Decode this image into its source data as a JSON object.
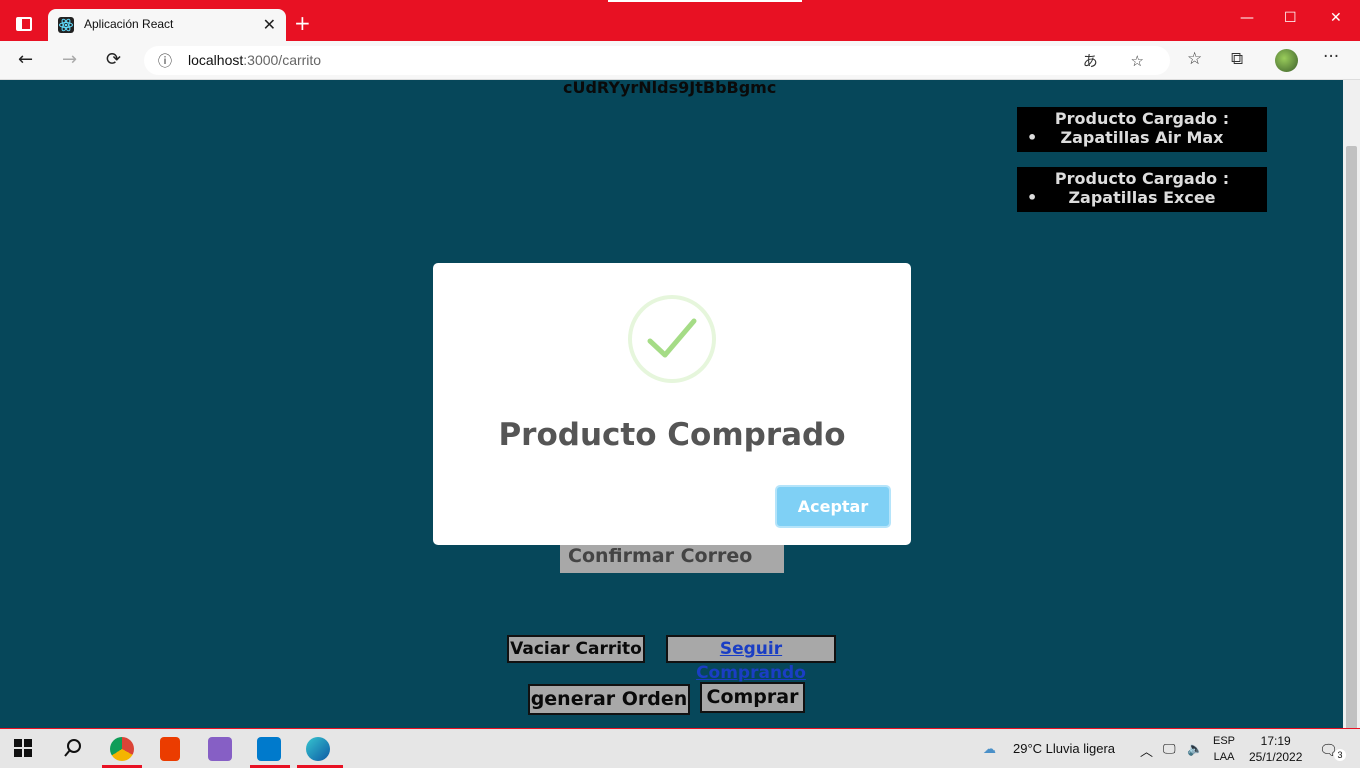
{
  "browser": {
    "tab_title": "Aplicación React",
    "tab_close": "✕",
    "new_tab": "+",
    "window_controls": [
      "—",
      "☐",
      "✕"
    ],
    "url_host": "localhost",
    "url_path": ":3000/carrito",
    "nav": {
      "back": "←",
      "forward": "→",
      "refresh": "⟳"
    },
    "url_icons": "あ ☆",
    "toolbar_icons": {
      "favorites": "☆",
      "collections": "⧉",
      "more": "···"
    }
  },
  "page": {
    "token": "cUdRYyrNlds9JtBbBgmc",
    "products": [
      {
        "label": "Producto Cargado :",
        "name": "Zapatillas Air Max"
      },
      {
        "label": "Producto Cargado :",
        "name": "Zapatillas Excee"
      }
    ],
    "confirm_email": "Confirmar Correo",
    "empty_cart": "Vaciar Carrito",
    "keep_shopping": "Seguir Comprando",
    "generate_order": "generar Orden",
    "buy": "Comprar"
  },
  "modal": {
    "title": "Producto Comprado",
    "accept": "Aceptar",
    "icon": "success-check-icon"
  },
  "taskbar": {
    "weather": "29°C  Lluvia ligera",
    "lang_top": "ESP",
    "lang_bottom": "LAA",
    "time": "17:19",
    "date": "25/1/2022",
    "notifications": "3"
  },
  "colors": {
    "accent": "#e81123",
    "page_bg": "#06475a",
    "button_bg": "#a8a8a8",
    "modal_button": "#7fd0f5",
    "check": "#a5dc86"
  }
}
